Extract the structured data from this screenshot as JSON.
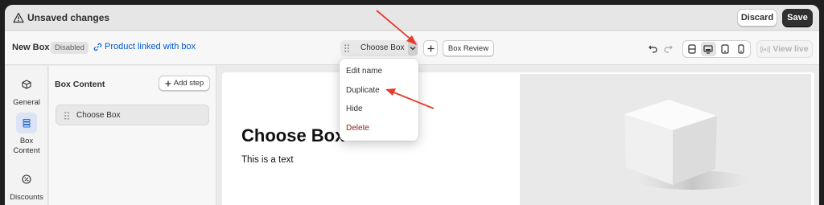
{
  "topbar": {
    "status_text": "Unsaved changes",
    "discard_label": "Discard",
    "save_label": "Save"
  },
  "toolbar": {
    "box_name": "New Box",
    "status_badge": "Disabled",
    "product_link": "Product linked with box",
    "step_select": "Choose Box",
    "add_icon": "plus-icon",
    "review_button": "Box Review",
    "view_live": "View live",
    "devices": [
      "fullscreen-icon",
      "desktop-icon",
      "tablet-icon",
      "mobile-icon"
    ],
    "active_device": "desktop-icon"
  },
  "leftnav": {
    "items": [
      {
        "label": "General",
        "icon": "cube-icon"
      },
      {
        "label": "Box\nContent",
        "icon": "layers-icon",
        "active": true
      },
      {
        "label": "Discounts",
        "icon": "discount-icon"
      }
    ]
  },
  "panel": {
    "title": "Box Content",
    "add_step": "Add step",
    "steps": [
      "Choose Box"
    ]
  },
  "preview": {
    "title": "Choose Box",
    "text": "This is a text"
  },
  "dropdown": {
    "items": [
      {
        "label": "Edit name"
      },
      {
        "label": "Duplicate"
      },
      {
        "label": "Hide"
      },
      {
        "label": "Delete",
        "danger": true
      }
    ]
  },
  "colors": {
    "accent": "#005bd3",
    "primary_button": "#303030",
    "danger": "#8e1f0b",
    "annotation_arrow": "#e53b2c"
  }
}
